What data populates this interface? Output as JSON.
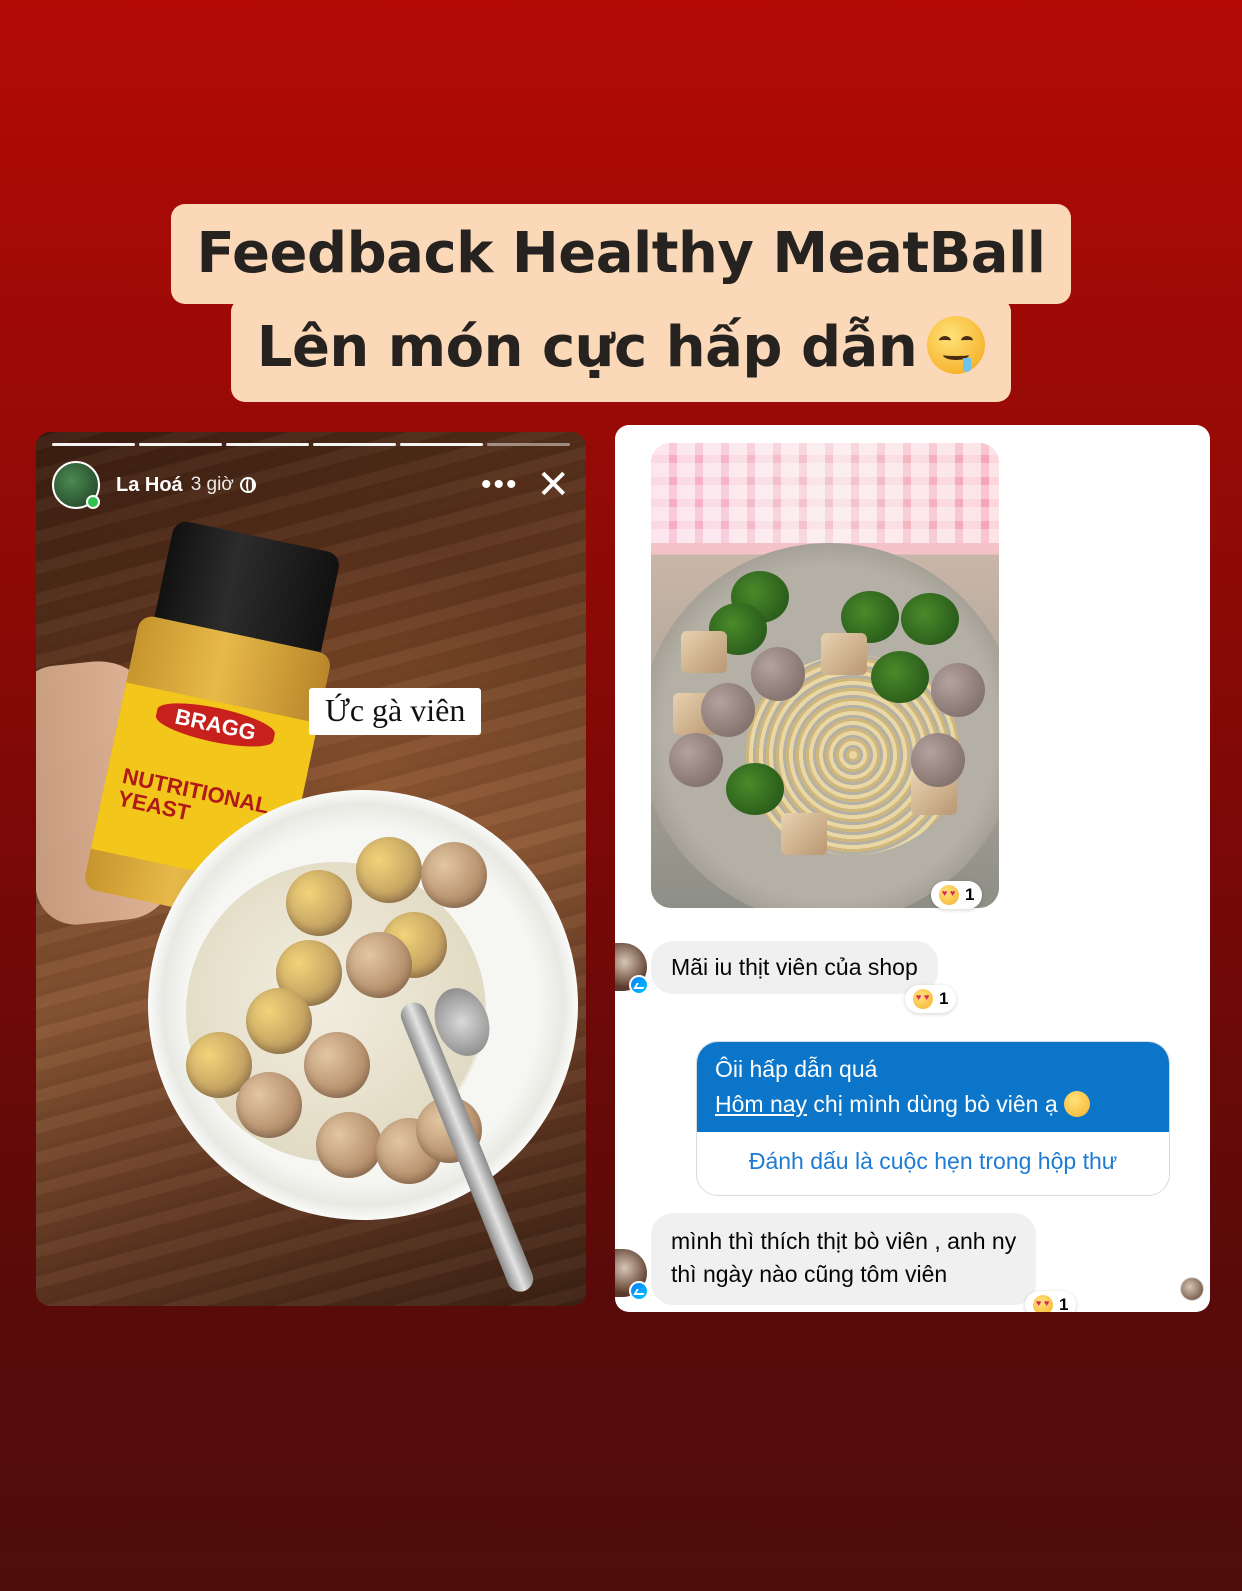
{
  "headline": {
    "line1": "Feedback Healthy MeatBall",
    "line2": "Lên món cực hấp dẫn",
    "line2_emoji": "drooling-face-icon"
  },
  "story": {
    "user_name": "La Hoá",
    "time": "3 giờ",
    "privacy_icon": "globe-icon",
    "more_icon": "more-icon",
    "close_icon": "close-icon",
    "progress_segments": 6,
    "caption": "Ức gà viên",
    "jar_brand": "BRAGG",
    "jar_product": "NUTRITIONAL YEAST"
  },
  "chat": {
    "photo_reaction": {
      "emoji": "heart-eyes-icon",
      "count": "1"
    },
    "messages": [
      {
        "direction": "incoming",
        "text": "Mãi iu thịt viên của shop",
        "reaction_count": "1"
      },
      {
        "direction": "outgoing",
        "line1": "Ôii hấp dẫn quá",
        "line2_underlined": "Hôm nay",
        "line2_rest": " chị mình dùng bò viên ạ",
        "action_label": "Đánh dấu là cuộc hẹn trong hộp thư"
      },
      {
        "direction": "incoming",
        "line1": "mình thì thích thịt bò viên , anh ny",
        "line2": "thì ngày nào cũng tôm viên",
        "reaction_count": "1"
      }
    ]
  },
  "colors": {
    "background_top": "#b30a06",
    "background_bottom": "#4e0d0b",
    "headline_bg": "#fbd9b8",
    "outgoing_bubble": "#0b75c9",
    "link_blue": "#1e7bd4"
  }
}
